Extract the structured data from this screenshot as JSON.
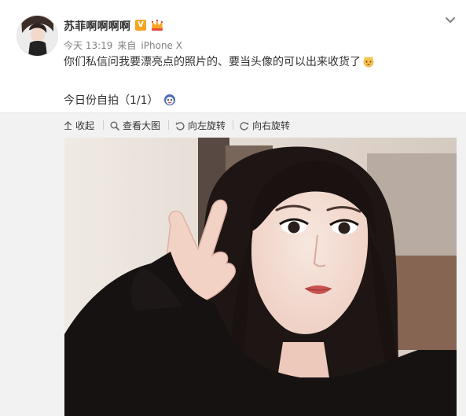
{
  "post": {
    "username": "苏菲啊啊啊啊",
    "vip_badge": "V",
    "time": "今天 13:19",
    "source_prefix": "来自",
    "source": "iPhone X",
    "text": "你们私信问我要漂亮点的照片的、要当头像的可以出来收货了",
    "photo_caption": "今日份自拍（1/1）"
  },
  "toolbar": {
    "collapse": "收起",
    "view_large": "查看大图",
    "rotate_left": "向左旋转",
    "rotate_right": "向右旋转"
  },
  "icons": {
    "vip": "vip-badge-icon",
    "crown": "crown-icon",
    "more": "chevron-down-icon",
    "emoji_cat": "cat-emoji-icon",
    "emoji_face": "face-emoji-icon",
    "collapse": "arrow-up-icon",
    "view_large": "search-icon",
    "rotate_left": "rotate-left-icon",
    "rotate_right": "rotate-right-icon"
  },
  "colors": {
    "text": "#333333",
    "meta": "#808080",
    "toolbar_bg": "#f2f2f2",
    "vip_orange": "#f6a623"
  }
}
